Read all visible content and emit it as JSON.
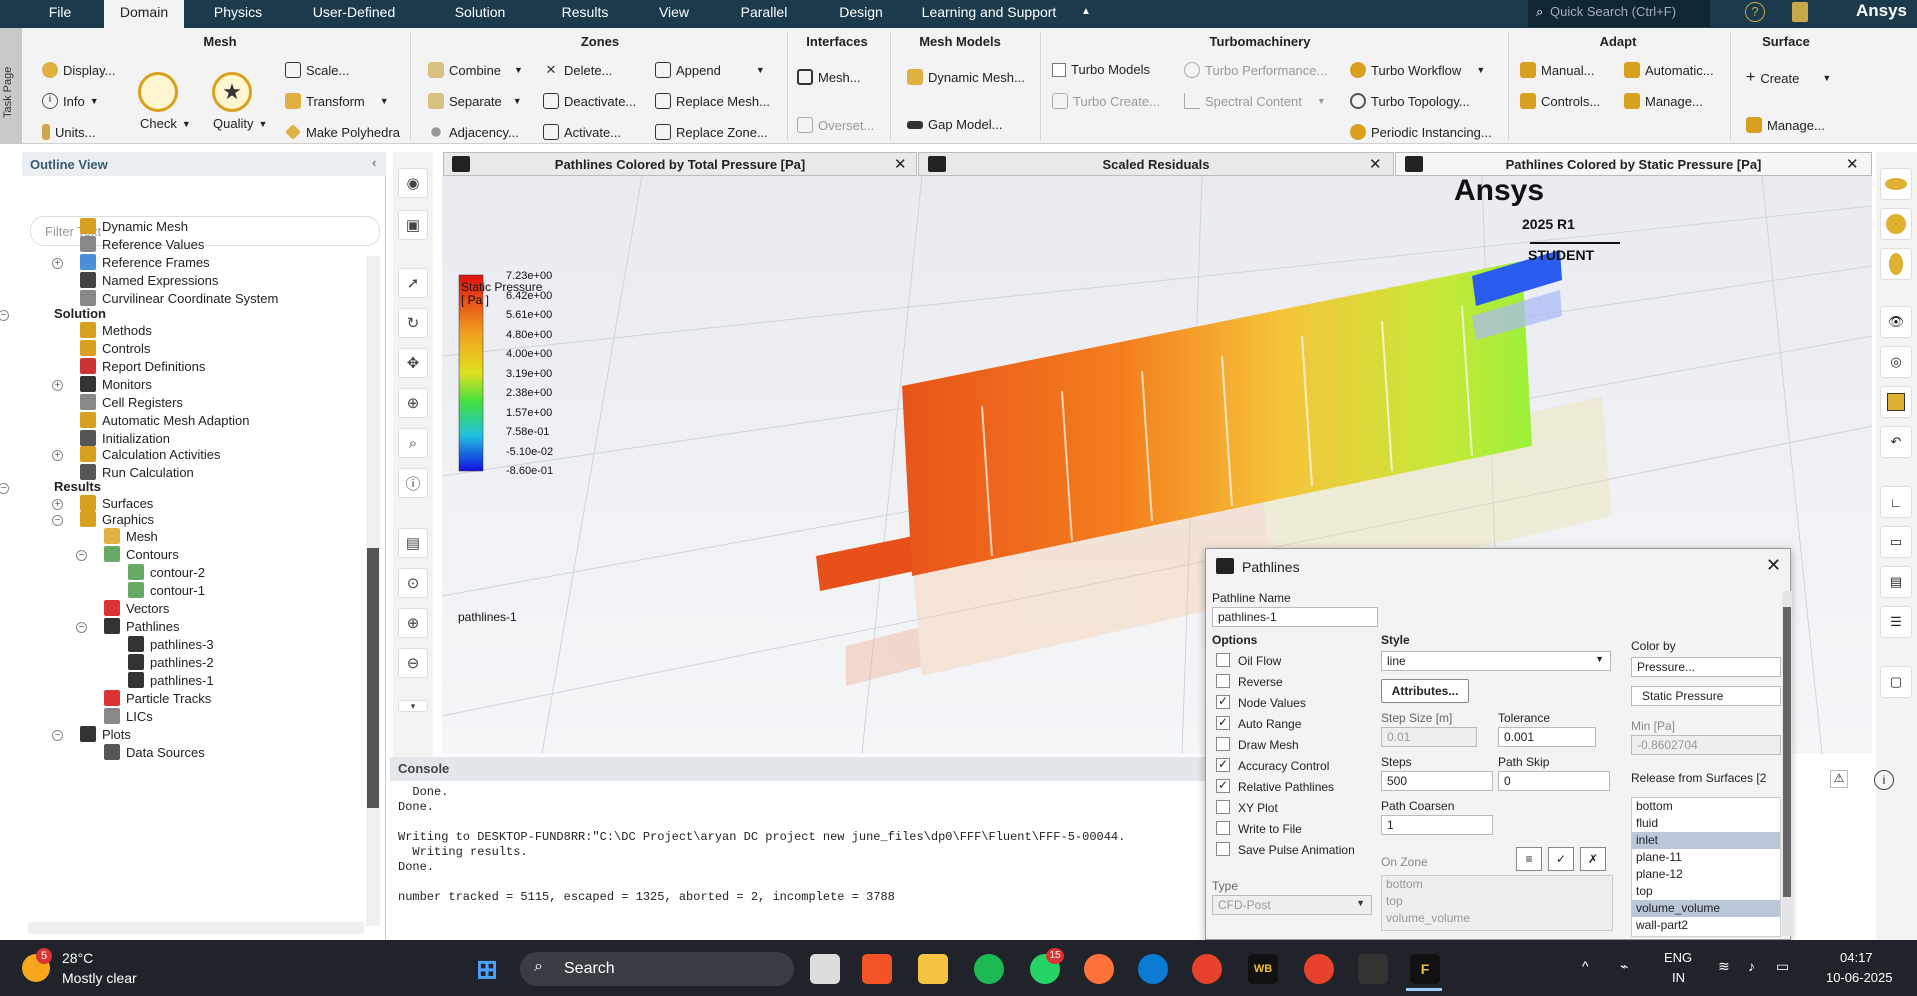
{
  "menu": {
    "tabs": [
      "File",
      "Domain",
      "Physics",
      "User-Defined",
      "Solution",
      "Results",
      "View",
      "Parallel",
      "Design",
      "Learning and Support"
    ],
    "search_placeholder": "Quick Search (Ctrl+F)",
    "logo": "Ansys"
  },
  "ribbon": {
    "task_page": "Task Page",
    "groups": {
      "mesh": "Mesh",
      "zones": "Zones",
      "interfaces": "Interfaces",
      "mesh_models": "Mesh Models",
      "turbomachinery": "Turbomachinery",
      "adapt": "Adapt",
      "surface": "Surface"
    },
    "mesh": {
      "display": "Display...",
      "info": "Info",
      "units": "Units...",
      "check": "Check",
      "quality": "Quality",
      "scale": "Scale...",
      "transform": "Transform",
      "make_polyhedra": "Make Polyhedra"
    },
    "zones": {
      "combine": "Combine",
      "separate": "Separate",
      "adjacency": "Adjacency...",
      "delete": "Delete...",
      "deactivate": "Deactivate...",
      "activate": "Activate...",
      "append": "Append",
      "replace_mesh": "Replace Mesh...",
      "replace_zone": "Replace Zone..."
    },
    "interfaces": {
      "mesh": "Mesh...",
      "overset": "Overset..."
    },
    "mesh_models": {
      "dynamic": "Dynamic Mesh...",
      "gap": "Gap Model..."
    },
    "turbo": {
      "models": "Turbo Models",
      "create": "Turbo Create...",
      "performance": "Turbo Performance...",
      "spectral": "Spectral Content",
      "workflow": "Turbo Workflow",
      "topology": "Turbo Topology...",
      "periodic": "Periodic Instancing..."
    },
    "adapt": {
      "manual": "Manual...",
      "controls": "Controls...",
      "automatic": "Automatic...",
      "manage": "Manage..."
    },
    "surface": {
      "create": "Create",
      "manage": "Manage..."
    }
  },
  "outline": {
    "title": "Outline View",
    "filter_placeholder": "Filter Text",
    "items": [
      "Dynamic Mesh",
      "Reference Values",
      "Reference Frames",
      "Named Expressions",
      "Curvilinear Coordinate System",
      "Solution",
      "Methods",
      "Controls",
      "Report Definitions",
      "Monitors",
      "Cell Registers",
      "Automatic Mesh Adaption",
      "Initialization",
      "Calculation Activities",
      "Run Calculation",
      "Results",
      "Surfaces",
      "Graphics",
      "Mesh",
      "Contours",
      "contour-2",
      "contour-1",
      "Vectors",
      "Pathlines",
      "pathlines-3",
      "pathlines-2",
      "pathlines-1",
      "Particle Tracks",
      "LICs",
      "Plots",
      "Data Sources"
    ]
  },
  "tabs": [
    "Pathlines Colored by Total Pressure [Pa]",
    "Scaled Residuals",
    "Pathlines Colored by Static Pressure [Pa]"
  ],
  "viewport": {
    "brand": "Ansys",
    "version": "2025 R1",
    "edition": "STUDENT",
    "legend_title": "Static Pressure",
    "legend_unit": "[ Pa ]",
    "legend_ticks": [
      "7.23e+00",
      "6.42e+00",
      "5.61e+00",
      "4.80e+00",
      "4.00e+00",
      "3.19e+00",
      "2.38e+00",
      "1.57e+00",
      "7.58e-01",
      "-5.10e-02",
      "-8.60e-01"
    ],
    "pathline_label": "pathlines-1"
  },
  "console": {
    "title": "Console",
    "lines": [
      "  Done.",
      "Done.",
      "",
      "Writing to DESKTOP-FUND8RR:\"C:\\DC Project\\aryan DC project new june_files\\dp0\\FFF\\Fluent\\FFF-5-00044.",
      "  Writing results.",
      "Done.",
      "",
      "number tracked = 5115, escaped = 1325, aborted = 2, incomplete = 3788"
    ]
  },
  "dialog": {
    "title": "Pathlines",
    "name_label": "Pathline Name",
    "name_value": "pathlines-1",
    "options_label": "Options",
    "options": [
      {
        "label": "Oil Flow",
        "checked": false
      },
      {
        "label": "Reverse",
        "checked": false
      },
      {
        "label": "Node Values",
        "checked": true
      },
      {
        "label": "Auto Range",
        "checked": true
      },
      {
        "label": "Draw Mesh",
        "checked": false
      },
      {
        "label": "Accuracy Control",
        "checked": true
      },
      {
        "label": "Relative Pathlines",
        "checked": true
      },
      {
        "label": "XY Plot",
        "checked": false
      },
      {
        "label": "Write to File",
        "checked": false
      },
      {
        "label": "Save Pulse Animation",
        "checked": false
      }
    ],
    "style_label": "Style",
    "style_value": "line",
    "attributes": "Attributes...",
    "step_size_label": "Step Size [m]",
    "step_size": "0.01",
    "tolerance_label": "Tolerance",
    "tolerance": "0.001",
    "steps_label": "Steps",
    "steps": "500",
    "path_skip_label": "Path Skip",
    "path_skip": "0",
    "path_coarsen_label": "Path Coarsen",
    "path_coarsen": "1",
    "on_zone_label": "On Zone",
    "on_zone": [
      "bottom",
      "top",
      "volume_volume"
    ],
    "type_label": "Type",
    "type_value": "CFD-Post",
    "color_by_label": "Color by",
    "color_by_1": "Pressure...",
    "color_by_2": "Static Pressure",
    "min_label": "Min [Pa]",
    "min_value": "-0.8602704",
    "release_label": "Release from Surfaces [2",
    "surfaces": [
      {
        "name": "bottom",
        "selected": false
      },
      {
        "name": "fluid",
        "selected": false
      },
      {
        "name": "inlet",
        "selected": true
      },
      {
        "name": "plane-11",
        "selected": false
      },
      {
        "name": "plane-12",
        "selected": false
      },
      {
        "name": "top",
        "selected": false
      },
      {
        "name": "volume_volume",
        "selected": true
      },
      {
        "name": "wall-part2",
        "selected": false
      }
    ]
  },
  "taskbar": {
    "weather_temp": "28°C",
    "weather_desc": "Mostly clear",
    "weather_badge": "5",
    "search": "Search",
    "whatsapp_badge": "15",
    "wb": "WB",
    "lang1": "ENG",
    "lang2": "IN",
    "time": "04:17",
    "date": "10-06-2025"
  }
}
